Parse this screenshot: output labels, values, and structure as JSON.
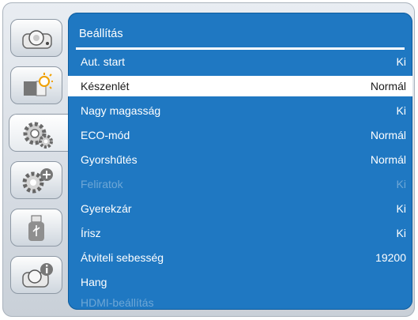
{
  "menu": {
    "title": "Beállítás",
    "items": [
      {
        "label": "Aut. start",
        "value": "Ki"
      },
      {
        "label": "Készenlét",
        "value": "Normál"
      },
      {
        "label": "Nagy magasság",
        "value": "Ki"
      },
      {
        "label": "ECO-mód",
        "value": "Normál"
      },
      {
        "label": "Gyorshűtés",
        "value": "Normál"
      },
      {
        "label": "Feliratok",
        "value": "Ki"
      },
      {
        "label": "Gyerekzár",
        "value": "Ki"
      },
      {
        "label": "Írisz",
        "value": "Ki"
      },
      {
        "label": "Átviteli sebesség",
        "value": "19200"
      },
      {
        "label": "Hang",
        "value": ""
      },
      {
        "label": "HDMI-beállítás",
        "value": ""
      }
    ]
  },
  "sidebar": {
    "tabs": [
      {
        "icon": "projector-icon"
      },
      {
        "icon": "image-brightness-icon"
      },
      {
        "icon": "gears-icon",
        "active": true
      },
      {
        "icon": "gear-plus-icon"
      },
      {
        "icon": "usb-icon"
      },
      {
        "icon": "projector-info-icon"
      }
    ]
  },
  "colors": {
    "panel": "#1f78c2",
    "disabled_text": "#6ea7d6",
    "selected_row": "#ffffff"
  }
}
